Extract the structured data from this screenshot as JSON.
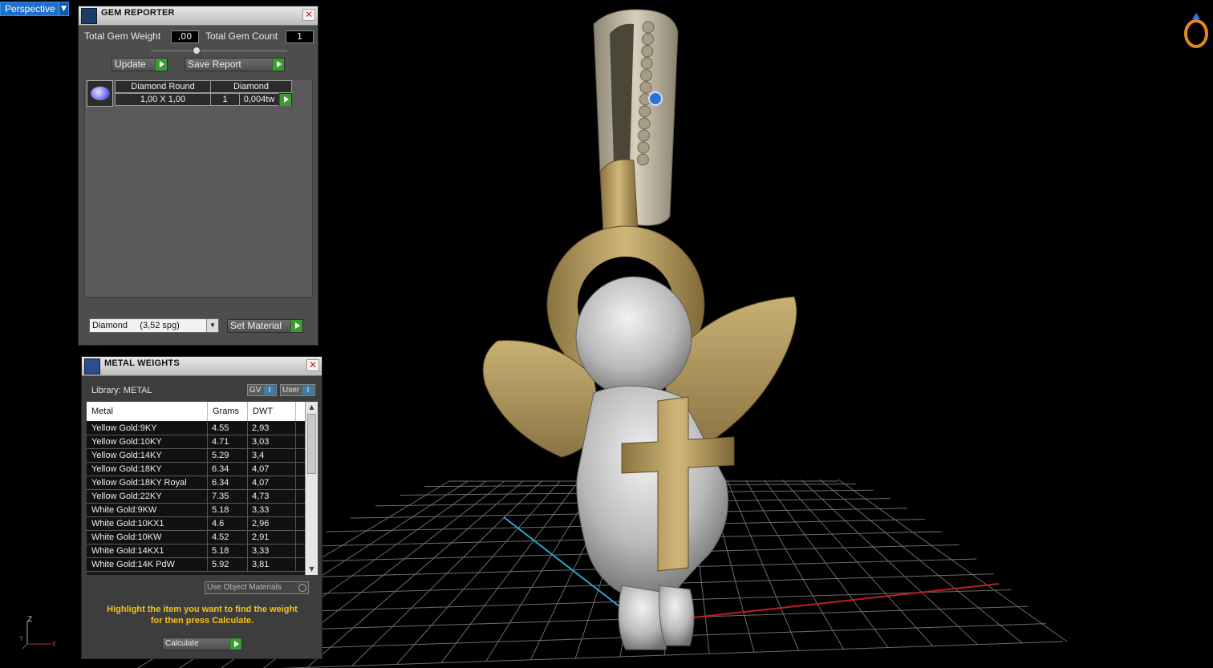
{
  "viewport": {
    "view_name": "Perspective"
  },
  "gem_reporter": {
    "title": "GEM REPORTER",
    "total_gem_weight_label": "Total Gem Weight",
    "total_gem_weight_value": ",00",
    "total_gem_count_label": "Total Gem Count",
    "total_gem_count_value": "1",
    "update_label": "Update",
    "save_report_label": "Save Report",
    "gem": {
      "name": "Diamond Round",
      "material": "Diamond",
      "size": "1,00 X 1,00",
      "count": "1",
      "weight": "0,004tw"
    },
    "material_select": "Diamond     (3,52 spg)",
    "set_material_label": "Set Material"
  },
  "metal_weights": {
    "title": "METAL WEIGHTS",
    "library_label": "Library: METAL",
    "gv_label": "GV",
    "user_label": "User",
    "columns": [
      "Metal",
      "Grams",
      "DWT"
    ],
    "rows": [
      [
        "Yellow Gold:9KY",
        "4.55",
        "2,93"
      ],
      [
        "Yellow Gold:10KY",
        "4.71",
        "3,03"
      ],
      [
        "Yellow Gold:14KY",
        "5.29",
        "3,4"
      ],
      [
        "Yellow Gold:18KY",
        "6.34",
        "4,07"
      ],
      [
        "Yellow Gold:18KY Royal",
        "6.34",
        "4,07"
      ],
      [
        "Yellow Gold:22KY",
        "7.35",
        "4,73"
      ],
      [
        "White Gold:9KW",
        "5.18",
        "3,33"
      ],
      [
        "White Gold:10KX1",
        "4.6",
        "2,96"
      ],
      [
        "White Gold:10KW",
        "4.52",
        "2,91"
      ],
      [
        "White Gold:14KX1",
        "5.18",
        "3,33"
      ],
      [
        "White Gold:14K PdW",
        "5.92",
        "3,81"
      ]
    ],
    "use_object_materials_label": "Use Object Materials",
    "hint_line1": "Highlight the item you want to find the weight",
    "hint_line2": "for then press Calculate.",
    "calculate_label": "Calculate"
  },
  "gizmo": {
    "z": "Z",
    "y": "Y",
    "x": "X"
  },
  "colors": {
    "accent_blue": "#1e6fc9",
    "hint_yellow": "#f5c21b",
    "go_green": "#3e9b34",
    "gold": "#b3975b",
    "silver": "#c8c8c8"
  }
}
